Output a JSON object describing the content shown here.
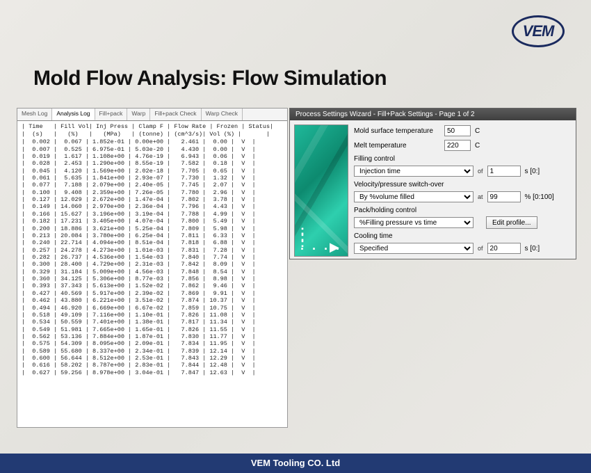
{
  "brand": {
    "logo_text": "VEM",
    "footer_text": "VEM Tooling CO. Ltd"
  },
  "page_title": "Mold Flow Analysis: Flow Simulation",
  "log_panel": {
    "tabs": [
      "Mesh Log",
      "Analysis Log",
      "Fill+pack",
      "Warp",
      "Fill+pack Check",
      "Warp Check"
    ],
    "active_tab_index": 1,
    "header_line1": "| Time   | Fill Vol| Inj Press | Clamp F | Flow Rate | Frozen | Status|",
    "header_line2": "|  (s)   |   (%)   |   (MPa)   | (tonne) | (cm^3/s)| Vol (%) |       |",
    "rows": [
      [
        "0.002",
        "0.067",
        "1.852e-01",
        "0.00e+00",
        "2.461",
        "0.00",
        "V"
      ],
      [
        "0.007",
        "0.525",
        "6.975e-01",
        "5.03e-20",
        "4.430",
        "0.00",
        "V"
      ],
      [
        "0.019",
        "1.617",
        "1.108e+00",
        "4.76e-19",
        "6.943",
        "0.06",
        "V"
      ],
      [
        "0.028",
        "2.453",
        "1.290e+00",
        "8.55e-19",
        "7.582",
        "0.18",
        "V"
      ],
      [
        "0.045",
        "4.120",
        "1.569e+00",
        "2.02e-18",
        "7.705",
        "0.65",
        "V"
      ],
      [
        "0.061",
        "5.635",
        "1.841e+00",
        "2.93e-07",
        "7.730",
        "1.32",
        "V"
      ],
      [
        "0.077",
        "7.188",
        "2.079e+00",
        "2.40e-05",
        "7.745",
        "2.07",
        "V"
      ],
      [
        "0.100",
        "9.408",
        "2.359e+00",
        "7.26e-05",
        "7.780",
        "2.96",
        "V"
      ],
      [
        "0.127",
        "12.029",
        "2.672e+00",
        "1.47e-04",
        "7.802",
        "3.78",
        "V"
      ],
      [
        "0.149",
        "14.060",
        "2.970e+00",
        "2.36e-04",
        "7.796",
        "4.43",
        "V"
      ],
      [
        "0.166",
        "15.627",
        "3.196e+00",
        "3.19e-04",
        "7.788",
        "4.99",
        "V"
      ],
      [
        "0.182",
        "17.231",
        "3.405e+00",
        "4.07e-04",
        "7.800",
        "5.49",
        "V"
      ],
      [
        "0.200",
        "18.886",
        "3.621e+00",
        "5.25e-04",
        "7.809",
        "5.98",
        "V"
      ],
      [
        "0.213",
        "20.084",
        "3.780e+00",
        "6.25e-04",
        "7.811",
        "6.33",
        "V"
      ],
      [
        "0.240",
        "22.714",
        "4.094e+00",
        "8.51e-04",
        "7.818",
        "6.88",
        "V"
      ],
      [
        "0.257",
        "24.278",
        "4.273e+00",
        "1.01e-03",
        "7.831",
        "7.28",
        "V"
      ],
      [
        "0.282",
        "26.737",
        "4.536e+00",
        "1.54e-03",
        "7.840",
        "7.74",
        "V"
      ],
      [
        "0.300",
        "28.400",
        "4.729e+00",
        "2.31e-03",
        "7.842",
        "8.09",
        "V"
      ],
      [
        "0.329",
        "31.184",
        "5.009e+00",
        "4.56e-03",
        "7.848",
        "8.54",
        "V"
      ],
      [
        "0.360",
        "34.125",
        "5.306e+00",
        "8.77e-03",
        "7.856",
        "8.98",
        "V"
      ],
      [
        "0.393",
        "37.343",
        "5.613e+00",
        "1.52e-02",
        "7.862",
        "9.46",
        "V"
      ],
      [
        "0.427",
        "40.569",
        "5.917e+00",
        "2.39e-02",
        "7.869",
        "9.91",
        "V"
      ],
      [
        "0.462",
        "43.880",
        "6.221e+00",
        "3.51e-02",
        "7.874",
        "10.37",
        "V"
      ],
      [
        "0.494",
        "46.920",
        "6.669e+00",
        "6.67e-02",
        "7.859",
        "10.75",
        "V"
      ],
      [
        "0.518",
        "49.109",
        "7.116e+00",
        "1.10e-01",
        "7.826",
        "11.08",
        "V"
      ],
      [
        "0.534",
        "50.559",
        "7.401e+00",
        "1.38e-01",
        "7.817",
        "11.34",
        "V"
      ],
      [
        "0.549",
        "51.981",
        "7.665e+00",
        "1.65e-01",
        "7.826",
        "11.55",
        "V"
      ],
      [
        "0.562",
        "53.136",
        "7.884e+00",
        "1.87e-01",
        "7.830",
        "11.77",
        "V"
      ],
      [
        "0.575",
        "54.309",
        "8.095e+00",
        "2.09e-01",
        "7.834",
        "11.95",
        "V"
      ],
      [
        "0.589",
        "55.680",
        "8.337e+00",
        "2.34e-01",
        "7.839",
        "12.14",
        "V"
      ],
      [
        "0.600",
        "56.644",
        "8.512e+00",
        "2.53e-01",
        "7.843",
        "12.29",
        "V"
      ],
      [
        "0.616",
        "58.202",
        "8.787e+00",
        "2.83e-01",
        "7.844",
        "12.48",
        "V"
      ],
      [
        "0.627",
        "59.256",
        "8.978e+00",
        "3.04e-01",
        "7.847",
        "12.63",
        "V"
      ]
    ]
  },
  "wizard": {
    "title": "Process Settings Wizard - Fill+Pack Settings - Page 1 of 2",
    "mold_surface_temp": {
      "label": "Mold surface temperature",
      "value": "50",
      "unit": "C"
    },
    "melt_temp": {
      "label": "Melt temperature",
      "value": "220",
      "unit": "C"
    },
    "filling_control": {
      "label": "Filling control",
      "selected": "Injection time",
      "of_label": "of",
      "value": "1",
      "unit": "s [0:]"
    },
    "vp_switch": {
      "label": "Velocity/pressure switch-over",
      "selected": "By %volume filled",
      "at_label": "at",
      "value": "99",
      "unit": "% [0:100]"
    },
    "pack_holding": {
      "label": "Pack/holding control",
      "selected": "%Filling pressure vs time",
      "button_label": "Edit profile..."
    },
    "cooling": {
      "label": "Cooling time",
      "selected": "Specified",
      "of_label": "of",
      "value": "20",
      "unit": "s [0:]"
    }
  }
}
